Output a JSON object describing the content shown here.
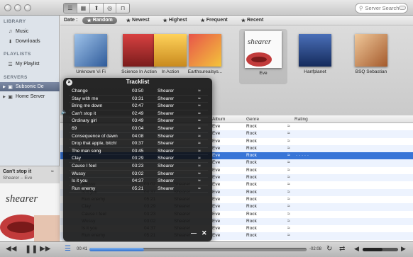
{
  "toolbar": {
    "view_buttons": [
      "☰",
      "▦",
      "⬆",
      "◎",
      "⊓"
    ],
    "search_placeholder": "Server Search"
  },
  "filterbar": {
    "label": "Date :",
    "filters": [
      {
        "label": "Random",
        "active": true
      },
      {
        "label": "Newest",
        "active": false
      },
      {
        "label": "Highest",
        "active": false
      },
      {
        "label": "Frequent",
        "active": false
      },
      {
        "label": "Recent",
        "active": false
      }
    ]
  },
  "sidebar": {
    "library_header": "LIBRARY",
    "library_items": [
      "Music",
      "Downloads"
    ],
    "playlists_header": "PLAYLISTS",
    "playlist_items": [
      "My Playlist"
    ],
    "servers_header": "SERVERS",
    "server_items": [
      "Subsonic De",
      "Home Server"
    ]
  },
  "nowplaying": {
    "title": "Can't stop it",
    "subtitle": "Shearer – Eve"
  },
  "albums": [
    {
      "caption": "Unknown Vi Fi",
      "color": "#4d7bb6"
    },
    {
      "caption": "Science In Action",
      "color": "#b43c3c"
    },
    {
      "caption": "In Action",
      "color": "#e4ac2c"
    },
    {
      "caption": "Earthsurealsys...",
      "color": "#d4493f"
    },
    {
      "caption": "Eve",
      "color": "#ffffff"
    },
    {
      "caption": "Hanfplanet",
      "color": "#2a4b8f"
    },
    {
      "caption": "BSQ Sebastian",
      "color": "#cf8a4d"
    }
  ],
  "table": {
    "headers": {
      "album": "Album",
      "genre": "Genre",
      "rating": "Rating"
    },
    "rows": [
      {
        "title": "",
        "time": "",
        "artist": "",
        "album": "Eve",
        "genre": "Rock",
        "selected": false
      },
      {
        "title": "",
        "time": "",
        "artist": "",
        "album": "Eve",
        "genre": "Rock",
        "selected": false
      },
      {
        "title": "",
        "time": "",
        "artist": "",
        "album": "Eve",
        "genre": "Rock",
        "selected": false
      },
      {
        "title": "",
        "time": "",
        "artist": "",
        "album": "Eve",
        "genre": "Rock",
        "selected": false
      },
      {
        "title": "",
        "time": "",
        "artist": "",
        "album": "Eve",
        "genre": "Rock",
        "selected": true
      },
      {
        "title": "",
        "time": "",
        "artist": "",
        "album": "Eve",
        "genre": "Rock",
        "selected": false
      },
      {
        "title": "",
        "time": "",
        "artist": "",
        "album": "Eve",
        "genre": "Rock",
        "selected": false
      },
      {
        "title": "",
        "time": "",
        "artist": "",
        "album": "Eve",
        "genre": "Rock",
        "selected": false
      },
      {
        "title": "Wussy",
        "time": "03:02",
        "artist": "Shearer",
        "album": "Eve",
        "genre": "Rock",
        "selected": false
      },
      {
        "title": "Is it you",
        "time": "04:37",
        "artist": "Shearer",
        "album": "Eve",
        "genre": "Rock",
        "selected": false
      },
      {
        "title": "Run enemy",
        "time": "05:21",
        "artist": "Shearer",
        "album": "Eve",
        "genre": "Rock",
        "selected": false
      },
      {
        "title": "Clay",
        "time": "03:29",
        "artist": "Shearer",
        "album": "Eve",
        "genre": "Rock",
        "selected": false
      },
      {
        "title": "Cause I feel",
        "time": "03:23",
        "artist": "Shearer",
        "album": "Eve",
        "genre": "Rock",
        "selected": false
      },
      {
        "title": "Wussy",
        "time": "03:02",
        "artist": "Shearer",
        "album": "Eve",
        "genre": "Rock",
        "selected": false
      },
      {
        "title": "Is it you",
        "time": "04:37",
        "artist": "Shearer",
        "album": "Eve",
        "genre": "Rock",
        "selected": false
      },
      {
        "title": "Run enemy",
        "time": "05:21",
        "artist": "Shearer",
        "album": "Eve",
        "genre": "Rock",
        "selected": false
      }
    ]
  },
  "tracklist": {
    "title": "Tracklist",
    "tracks": [
      {
        "title": "Change",
        "time": "03:50",
        "artist": "Shearer"
      },
      {
        "title": "Stay with me",
        "time": "03:31",
        "artist": "Shearer"
      },
      {
        "title": "Bring me down",
        "time": "02:47",
        "artist": "Shearer"
      },
      {
        "title": "Can't stop it",
        "time": "02:49",
        "artist": "Shearer"
      },
      {
        "title": "Ordinary girl",
        "time": "03:49",
        "artist": "Shearer"
      },
      {
        "title": "69",
        "time": "03:04",
        "artist": "Shearer"
      },
      {
        "title": "Consequence of dawn",
        "time": "04:08",
        "artist": "Shearer"
      },
      {
        "title": "Drop that apple, bitch!",
        "time": "00:37",
        "artist": "Shearer"
      },
      {
        "title": "The man song",
        "time": "03:45",
        "artist": "Shearer"
      },
      {
        "title": "Clay",
        "time": "03:29",
        "artist": "Shearer"
      },
      {
        "title": "Cause I feel",
        "time": "03:23",
        "artist": "Shearer"
      },
      {
        "title": "Wussy",
        "time": "03:02",
        "artist": "Shearer"
      },
      {
        "title": "Is it you",
        "time": "04:37",
        "artist": "Shearer"
      },
      {
        "title": "Run enemy",
        "time": "05:21",
        "artist": "Shearer"
      }
    ]
  },
  "player": {
    "elapsed": "00:41",
    "remaining": "-02:08",
    "progress": 0.25,
    "volume": 0.55
  },
  "colors": {
    "accent": "#3875d7",
    "sidebar_selected": "#6b7894"
  }
}
